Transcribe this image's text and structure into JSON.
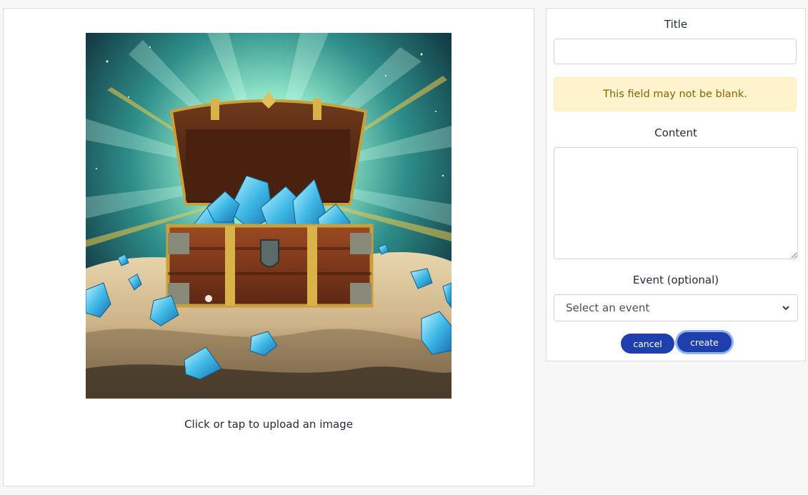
{
  "upload": {
    "image_alt": "Painted treasure chest overflowing with blue crystals",
    "hint": "Click or tap to upload an image"
  },
  "form": {
    "title_label": "Title",
    "title_value": "",
    "error_message": "This field may not be blank.",
    "content_label": "Content",
    "content_value": "",
    "event_label": "Event (optional)",
    "event_selected": "Select an event",
    "cancel_label": "cancel",
    "create_label": "create"
  },
  "colors": {
    "button_bg": "#1f3fae",
    "alert_bg": "#fff3cd",
    "alert_text": "#856404"
  },
  "icons": {
    "select_chevron": "chevron-down-icon"
  }
}
